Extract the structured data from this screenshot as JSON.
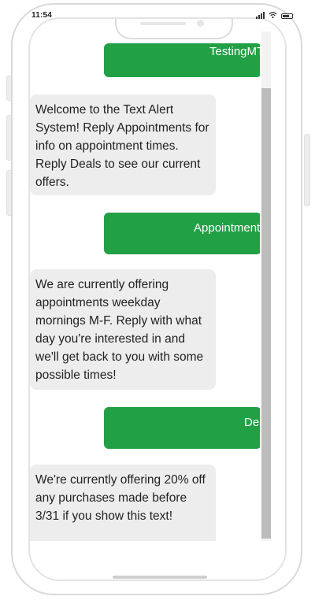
{
  "status_bar": {
    "time": "11:54",
    "icons": [
      "signal-icon",
      "wifi-icon",
      "battery-icon"
    ]
  },
  "conversation": {
    "messages": [
      {
        "direction": "outgoing",
        "text": "TestingMTA"
      },
      {
        "direction": "incoming",
        "text": "Welcome to the Text Alert System! Reply Appointments for info on appointment times. Reply Deals to see our current offers."
      },
      {
        "direction": "outgoing",
        "text": "Appointments"
      },
      {
        "direction": "incoming",
        "text": "We are currently offering appointments weekday mornings M-F. Reply with what day you're interested in and we'll get back to you with some possible times!"
      },
      {
        "direction": "outgoing",
        "text": "Deals"
      },
      {
        "direction": "incoming",
        "text": "We're currently offering 20% off any purchases made before 3/31 if you show this text!"
      }
    ]
  },
  "colors": {
    "outgoing_bubble": "#22a045",
    "incoming_bubble": "#ededed"
  }
}
